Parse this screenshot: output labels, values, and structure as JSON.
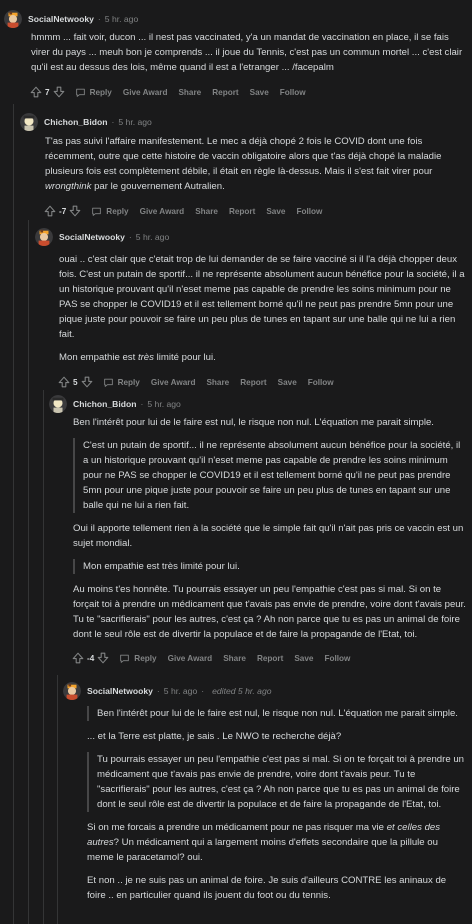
{
  "actions": {
    "reply": "Reply",
    "give_award": "Give Award",
    "share": "Share",
    "report": "Report",
    "save": "Save",
    "follow": "Follow"
  },
  "dot": "·",
  "comments": [
    {
      "author": "SocialNetwooky",
      "time": "5 hr. ago",
      "score": "7",
      "paragraphs": [
        "hmmm ... fait voir, ducon ... il nest pas vaccinated, y'a un mandat de vaccination en place, il se fais virer du pays ... meuh bon je comprends ... il joue du Tennis, c'est pas un commun mortel ... c'est clair qu'il est au dessus des lois, même quand il est a l'etranger ... /facepalm"
      ]
    },
    {
      "author": "Chichon_Bidon",
      "time": "5 hr. ago",
      "score": "-7",
      "p1_before": "T'as pas suivi l'affaire manifestement. Le mec a déjà chopé 2 fois le COVID dont une fois récemment, outre que cette histoire de vaccin obligatoire alors que t'as déjà chopé la maladie plusieurs fois est complètement débile, il était en règle là-dessus. Mais il s'est fait virer pour ",
      "p1_em": "wrongthink",
      "p1_after": " par le gouvernement Autralien."
    },
    {
      "author": "SocialNetwooky",
      "time": "5 hr. ago",
      "score": "5",
      "p1": "ouai .. c'est clair que c'etait trop de lui demander de se faire vacciné si il l'a déjà chopper deux fois. C'est un putain de sportif... il ne représente absolument aucun bénéfice pour la société, il a un historique prouvant qu'il n'eset meme pas capable de prendre les soins minimum pour ne PAS se chopper le COVID19 et il est tellement borné qu'il ne peut pas prendre 5mn pour une pique juste pour pouvoir se faire un peu plus de tunes en tapant sur une balle qui ne lui a rien fait.",
      "p2_before": "Mon empathie est ",
      "p2_em": "très",
      "p2_after": " limité pour lui."
    },
    {
      "author": "Chichon_Bidon",
      "time": "5 hr. ago",
      "score": "-4",
      "p1": "Ben l'intérêt pour lui de le faire est nul, le risque non nul. L'équation me parait simple.",
      "q1": "C'est un putain de sportif... il ne représente absolument aucun bénéfice pour la société, il a un historique prouvant qu'il n'eset meme pas capable de prendre les soins minimum pour ne PAS se chopper le COVID19 et il est tellement borné qu'il ne peut pas prendre 5mn pour une pique juste pour pouvoir se faire un peu plus de tunes en tapant sur une balle qui ne lui a rien fait.",
      "p2": "Oui il apporte tellement rien à la société que le simple fait qu'il n'ait pas pris ce vaccin est un sujet mondial.",
      "q2": "Mon empathie est très limité pour lui.",
      "p3": "Au moins t'es honnête. Tu pourrais essayer un peu l'empathie c'est pas si mal. Si on te forçait toi à prendre un médicament que t'avais pas envie de prendre, voire dont t'avais peur. Tu te \"sacrifierais\" pour les autres, c'est ça ? Ah non parce que tu es pas un animal de foire dont le seul rôle est de divertir la populace et de faire la propagande de l'Etat, toi."
    },
    {
      "author": "SocialNetwooky",
      "time": "5 hr. ago",
      "edited": "edited 5 hr. ago",
      "q1": "Ben l'intérêt pour lui de le faire est nul, le risque non nul. L'équation me parait simple.",
      "p1": "... et la Terre est platte, je sais . Le NWO te recherche déjà?",
      "q2": "Tu pourrais essayer un peu l'empathie c'est pas si mal. Si on te forçait toi à prendre un médicament que t'avais pas envie de prendre, voire dont t'avais peur. Tu te \"sacrifierais\" pour les autres, c'est ça ? Ah non parce que tu es pas un animal de foire dont le seul rôle est de divertir la populace et de faire la propagande de l'Etat, toi.",
      "p2_before": "Si on me forcais a prendre un médicament pour ne pas risquer ma vie ",
      "p2_em": "et celles des autres",
      "p2_after": "? Un médicament qui a largement moins d'effets secondaire que la pillule ou meme le paracetamol? oui.",
      "p3": "Et non .. je ne suis pas un animal de foire. Je suis d'ailleurs CONTRE les aninaux de foire .. en particulier quand ils jouent du foot ou du tennis."
    }
  ]
}
